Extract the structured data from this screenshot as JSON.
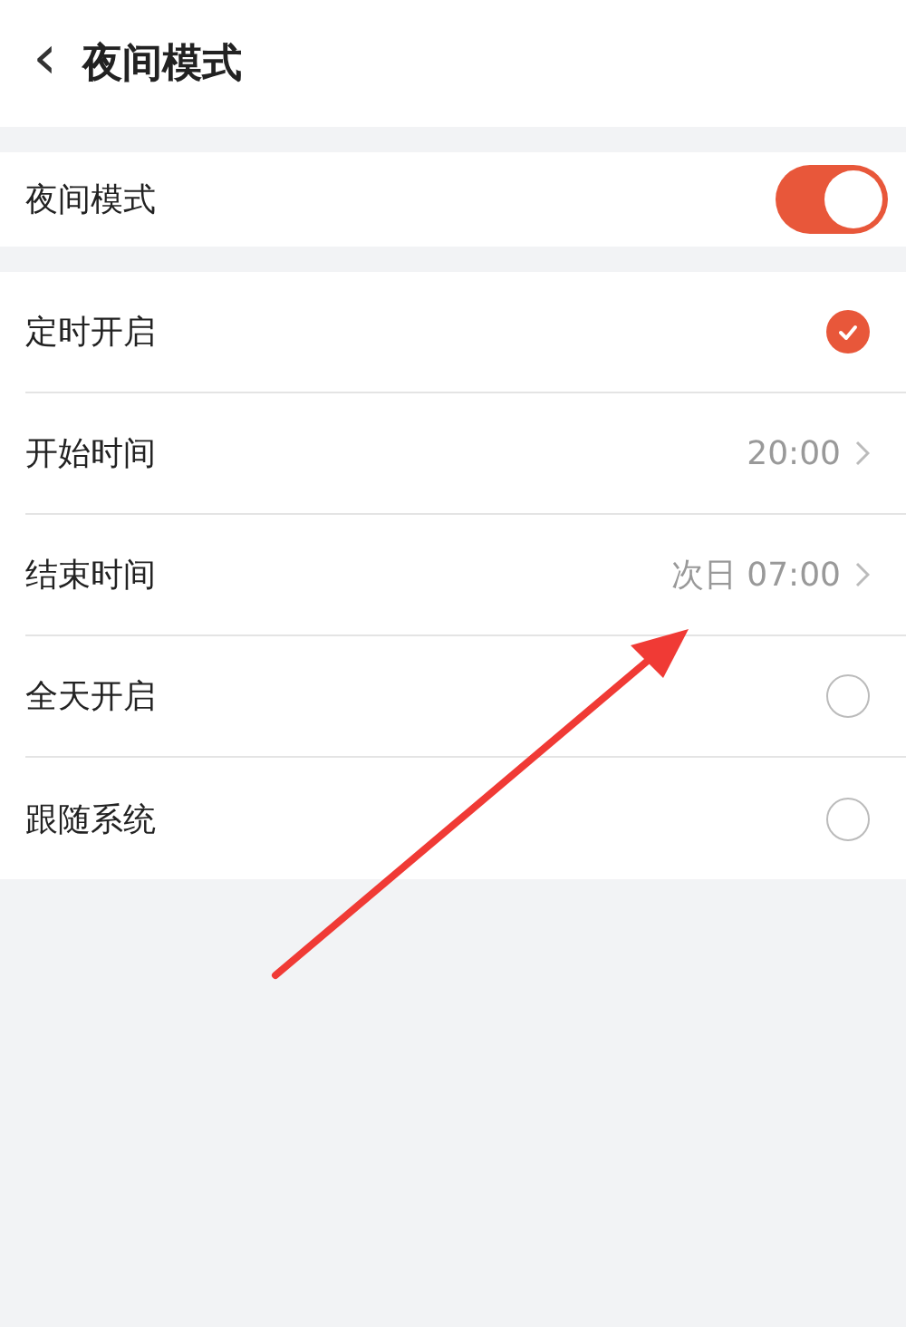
{
  "header": {
    "back_icon": "‹",
    "title": "夜间模式"
  },
  "night_mode": {
    "label": "夜间模式",
    "on": true
  },
  "options": [
    {
      "kind": "radio",
      "label": "定时开启",
      "selected": true
    },
    {
      "kind": "time",
      "label": "开始时间",
      "value": "20:00"
    },
    {
      "kind": "time",
      "label": "结束时间",
      "value": "次日 07:00"
    },
    {
      "kind": "radio",
      "label": "全天开启",
      "selected": false
    },
    {
      "kind": "radio",
      "label": "跟随系统",
      "selected": false
    }
  ],
  "annotation": {
    "kind": "arrow"
  }
}
